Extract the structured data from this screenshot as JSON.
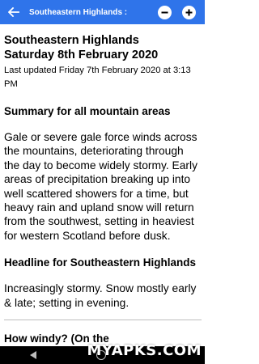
{
  "appbar": {
    "title": "Southeastern Highlands :",
    "back_icon": "arrow-left-icon",
    "zoom_out_icon": "minus-circle-icon",
    "zoom_in_icon": "plus-circle-icon",
    "color": "#2f74ea"
  },
  "forecast": {
    "area": "Southeastern Highlands",
    "date": "Saturday 8th February 2020",
    "last_updated": "Last updated Friday 7th February 2020 at 3:13 PM",
    "summary_heading": "Summary for all mountain areas",
    "summary_text": "Gale or severe gale force winds across the mountains, deteriorating through the day to become widely stormy. Early areas of precipitation breaking up into well scattered showers for a time, but heavy rain and upland snow will return from the southwest, setting in heaviest for western Scotland before dusk.",
    "headline_heading": "Headline for Southeastern Highlands",
    "headline_text": "Increasingly stormy. Snow mostly early & late; setting in evening.",
    "next_heading": "How windy? (On the"
  },
  "watermark": "MYAPKS.COM"
}
